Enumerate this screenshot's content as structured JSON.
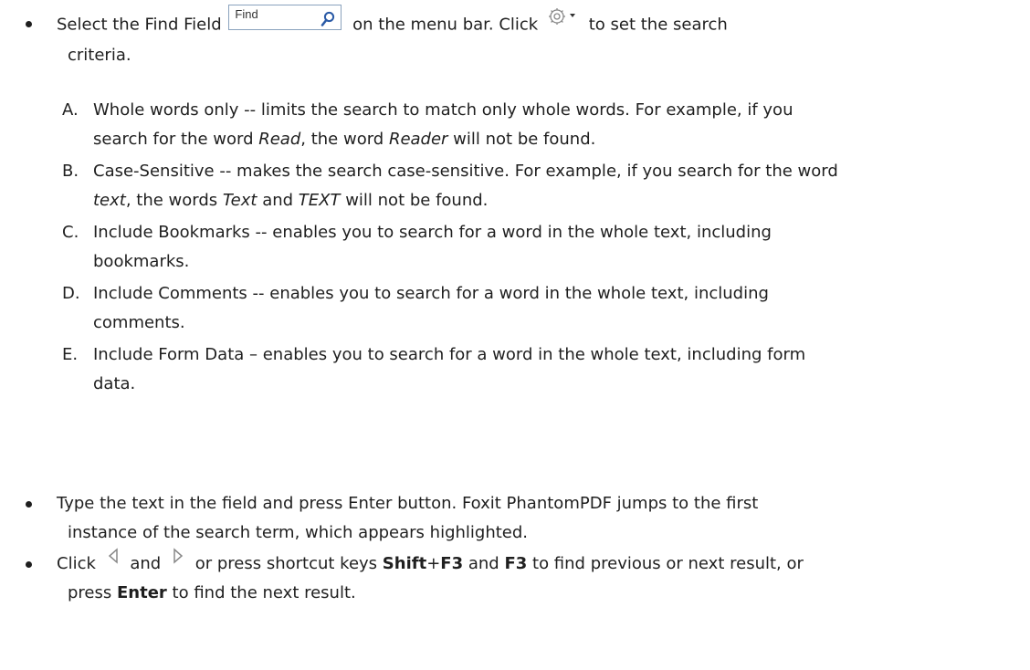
{
  "find_placeholder": "Find",
  "items": [
    {
      "p1": "Select the Find Field",
      "p2": "on the menu bar. Click",
      "p3": "to set the search",
      "p4": "criteria."
    }
  ],
  "options": [
    {
      "letter": "A.",
      "l1": "Whole words only -- limits the search to match only whole words. For example, if you",
      "l2a": "search for the word ",
      "l2b": "Read",
      "l2c": ", the word ",
      "l2d": "Reader",
      "l2e": " will not be found."
    },
    {
      "letter": "B.",
      "l1": "Case-Sensitive -- makes the search case-sensitive. For example, if you search for the word",
      "l2a": "text",
      "l2b": ", the words ",
      "l2c": "Text",
      "l2d": " and ",
      "l2e": "TEXT",
      "l2f": " will not be found."
    },
    {
      "letter": "C.",
      "l1": "Include Bookmarks -- enables you to search for a word in the whole text, including",
      "l2": "bookmarks."
    },
    {
      "letter": "D.",
      "l1": "Include Comments -- enables you to search for a word in the whole text, including",
      "l2": "comments."
    },
    {
      "letter": "E.",
      "l1": "Include Form Data – enables you to search for a word in the whole text, including form",
      "l2": "data."
    }
  ],
  "type": {
    "l1": "Type the text in the field and press Enter button. Foxit PhantomPDF jumps to the first",
    "l2": "instance of the search term, which appears highlighted."
  },
  "click": {
    "a": "Click",
    "b": "and",
    "c": "or press shortcut keys",
    "k1": "Shift",
    "plus": "+",
    "k2": "F3",
    "and": "and",
    "k3": "F3",
    "d": "to find previous or next result, or",
    "e": "press",
    "k4": "Enter",
    "f": "to find the next result."
  },
  "icons": [
    "search-icon",
    "gear-icon",
    "dropdown-arrow-icon",
    "previous-result-icon",
    "next-result-icon"
  ]
}
